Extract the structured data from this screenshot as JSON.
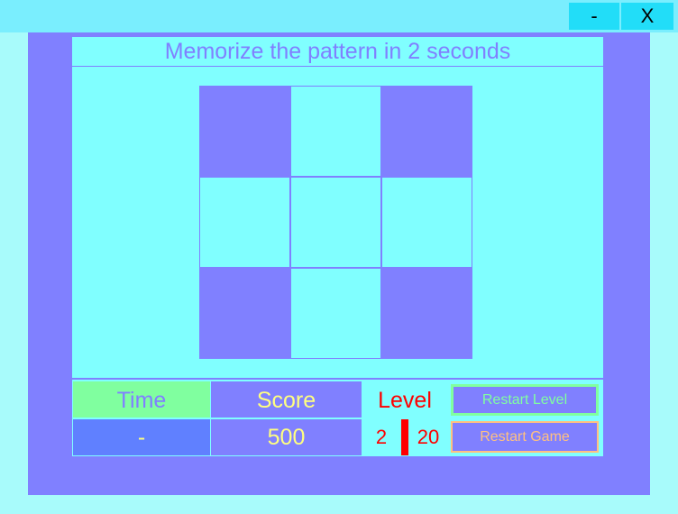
{
  "window": {
    "minimize_label": "-",
    "close_label": "X"
  },
  "header": {
    "instruction": "Memorize the pattern in 2 seconds"
  },
  "colors": {
    "filled": "#8080ff",
    "empty": "#80ffff"
  },
  "board": {
    "rows": 3,
    "cols": 3,
    "cells": [
      true,
      false,
      true,
      false,
      false,
      false,
      true,
      false,
      true
    ]
  },
  "stats": {
    "time_label": "Time",
    "time_value": "-",
    "score_label": "Score",
    "score_value": "500",
    "level_label": "Level",
    "level_current": "2",
    "level_max": "20"
  },
  "buttons": {
    "restart_level": "Restart Level",
    "restart_game": "Restart Game"
  }
}
